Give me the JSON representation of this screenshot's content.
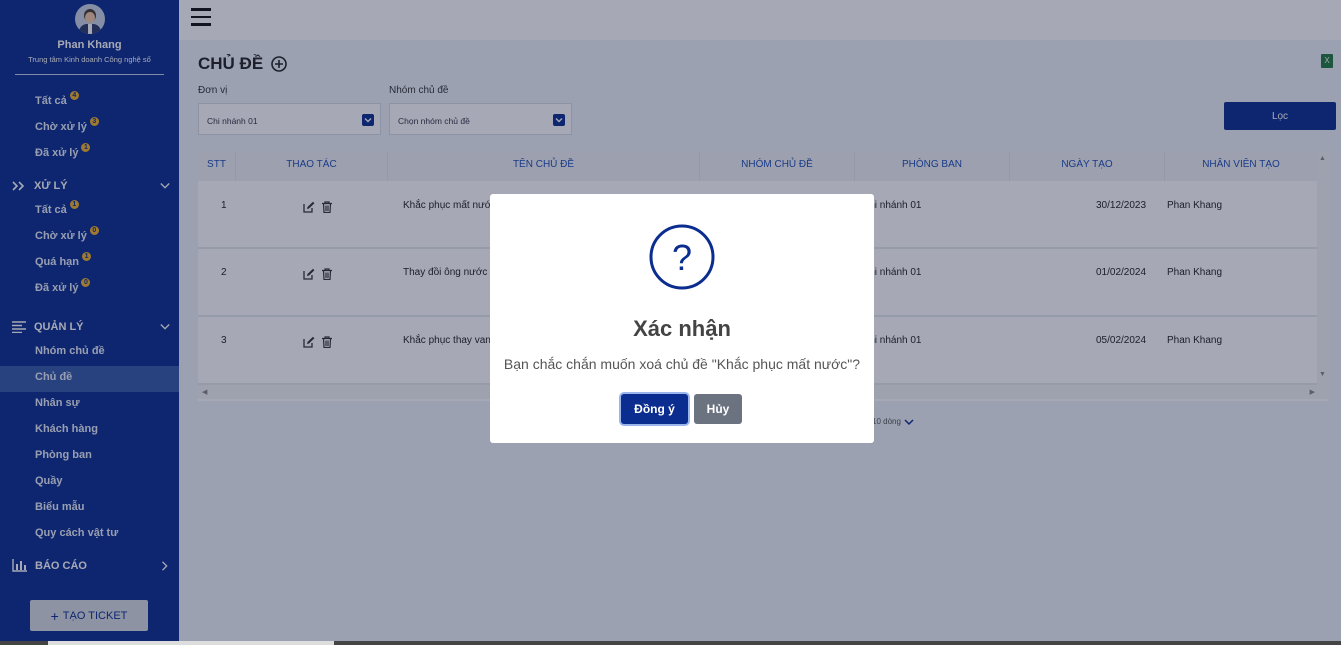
{
  "user": {
    "name": "Phan Khang",
    "org": "Trung tâm Kinh doanh Công nghệ số"
  },
  "sidebar": {
    "top_items": [
      {
        "label": "Tất cả",
        "badge": "4"
      },
      {
        "label": "Chờ xử lý",
        "badge": "3"
      },
      {
        "label": "Đã xử lý",
        "badge": "1"
      }
    ],
    "xuly": {
      "title": "XỬ LÝ",
      "items": [
        {
          "label": "Tất cả",
          "badge": "1"
        },
        {
          "label": "Chờ xử lý",
          "badge": "0"
        },
        {
          "label": "Quá hạn",
          "badge": "1"
        },
        {
          "label": "Đã xử lý",
          "badge": "0"
        }
      ]
    },
    "quanly": {
      "title": "QUẢN LÝ",
      "items": [
        "Nhóm chủ đề",
        "Chủ đề",
        "Nhân sự",
        "Khách hàng",
        "Phòng ban",
        "Quầy",
        "Biểu mẫu",
        "Quy cách vật tư"
      ],
      "active_index": 1
    },
    "baocao": {
      "title": "BÁO CÁO"
    },
    "create_button": "TẠO TICKET"
  },
  "page": {
    "title": "CHỦ ĐỀ",
    "filters": {
      "unit_label": "Đơn vị",
      "unit_value": "Chi nhánh 01",
      "group_label": "Nhóm chủ đề",
      "group_placeholder": "Chọn nhóm chủ đề",
      "filter_button": "Lọc"
    },
    "table": {
      "headers": [
        "STT",
        "THAO TÁC",
        "TÊN CHỦ ĐỀ",
        "NHÓM CHỦ ĐỀ",
        "PHÒNG BAN",
        "NGÀY TẠO",
        "NHÂN VIÊN TẠO"
      ],
      "rows": [
        {
          "stt": "1",
          "name": "Khắc phục mất nước",
          "dept": "Chi nhánh 01",
          "date": "30/12/2023",
          "creator": "Phan Khang"
        },
        {
          "stt": "2",
          "name": "Thay đồi ông nước",
          "dept": "Chi nhánh 01",
          "date": "01/02/2024",
          "creator": "Phan Khang"
        },
        {
          "stt": "3",
          "name": "Khắc phục thay van",
          "dept": "Chi nhánh 01",
          "date": "05/02/2024",
          "creator": "Phan Khang"
        }
      ]
    },
    "pager": {
      "page_size": "10 dòng"
    }
  },
  "dialog": {
    "title": "Xác nhận",
    "message": "Bạn chắc chắn muốn xoá chủ đề \"Khắc phục mất nước\"?",
    "ok": "Đồng ý",
    "cancel": "Hủy"
  },
  "colors": {
    "primary": "#0a2d8f",
    "accent": "#f0b429",
    "header_text": "#1e4db7"
  }
}
